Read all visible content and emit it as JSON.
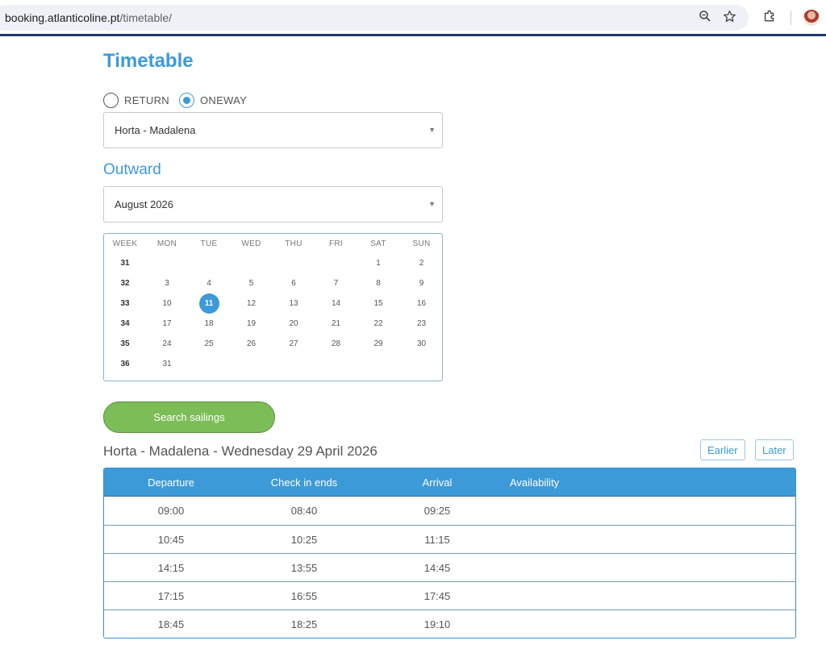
{
  "browser": {
    "url_host": "booking.atlanticoline.pt",
    "url_path": "/timetable/"
  },
  "page": {
    "title": "Timetable"
  },
  "trip_type": {
    "options": [
      {
        "label": "RETURN",
        "checked": false
      },
      {
        "label": "ONEWAY",
        "checked": true
      }
    ]
  },
  "route_select": {
    "value": "Horta - Madalena"
  },
  "outward": {
    "title": "Outward",
    "month_select": "August 2026"
  },
  "calendar": {
    "headers": [
      "WEEK",
      "MON",
      "TUE",
      "WED",
      "THU",
      "FRI",
      "SAT",
      "SUN"
    ],
    "selected_day": "11",
    "rows": [
      [
        "31",
        "",
        "",
        "",
        "",
        "",
        "1",
        "2"
      ],
      [
        "32",
        "3",
        "4",
        "5",
        "6",
        "7",
        "8",
        "9"
      ],
      [
        "33",
        "10",
        "11",
        "12",
        "13",
        "14",
        "15",
        "16"
      ],
      [
        "34",
        "17",
        "18",
        "19",
        "20",
        "21",
        "22",
        "23"
      ],
      [
        "35",
        "24",
        "25",
        "26",
        "27",
        "28",
        "29",
        "30"
      ],
      [
        "36",
        "31",
        "",
        "",
        "",
        "",
        "",
        ""
      ]
    ]
  },
  "search_button": "Search sailings",
  "results": {
    "title": "Horta - Madalena - Wednesday 29 April 2026",
    "earlier_label": "Earlier",
    "later_label": "Later",
    "columns": [
      "Departure",
      "Check in ends",
      "Arrival",
      "Availability"
    ],
    "rows": [
      {
        "departure": "09:00",
        "checkin": "08:40",
        "arrival": "09:25",
        "availability": ""
      },
      {
        "departure": "10:45",
        "checkin": "10:25",
        "arrival": "11:15",
        "availability": ""
      },
      {
        "departure": "14:15",
        "checkin": "13:55",
        "arrival": "14:45",
        "availability": ""
      },
      {
        "departure": "17:15",
        "checkin": "16:55",
        "arrival": "17:45",
        "availability": ""
      },
      {
        "departure": "18:45",
        "checkin": "18:25",
        "arrival": "19:10",
        "availability": ""
      }
    ]
  },
  "colors": {
    "accent": "#3d9ad8",
    "button_green": "#7dbd57",
    "browser_border": "#1f3a6e"
  }
}
